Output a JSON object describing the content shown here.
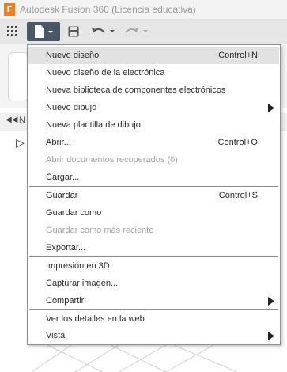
{
  "window": {
    "title": "Autodesk Fusion 360 (Licencia educativa)",
    "app_logo_letter": "F"
  },
  "toolbar": {
    "icons": [
      "grid-icon",
      "file-icon",
      "save-icon",
      "undo-icon",
      "redo-icon"
    ]
  },
  "browser": {
    "label_fragment": "N"
  },
  "colors": {
    "accent_logo": "#f07f23",
    "file_button": "#4a5766",
    "highlight": "#e2e2e2",
    "disabled_text": "#a3a3a3"
  },
  "menu": {
    "items": [
      {
        "label": "Nuevo diseño",
        "shortcut": "Control+N",
        "highlighted": true
      },
      {
        "label": "Nuevo diseño de la electrónica"
      },
      {
        "label": "Nueva biblioteca de componentes electrónicos"
      },
      {
        "label": "Nuevo dibujo",
        "submenu": true
      },
      {
        "label": "Nueva plantilla de dibujo"
      },
      {
        "label": "Abrir...",
        "shortcut": "Control+O"
      },
      {
        "label": "Abrir documentos recuperados (0)",
        "disabled": true
      },
      {
        "label": "Cargar..."
      },
      {
        "label": "Guardar",
        "shortcut": "Control+S"
      },
      {
        "label": "Guardar como"
      },
      {
        "label": "Guardar como más reciente",
        "disabled": true
      },
      {
        "label": "Exportar..."
      },
      {
        "label": "Impresión en 3D"
      },
      {
        "label": "Capturar imagen..."
      },
      {
        "label": "Compartir",
        "submenu": true
      },
      {
        "label": "Ver los detalles en la web"
      },
      {
        "label": "Vista",
        "submenu": true
      }
    ]
  }
}
